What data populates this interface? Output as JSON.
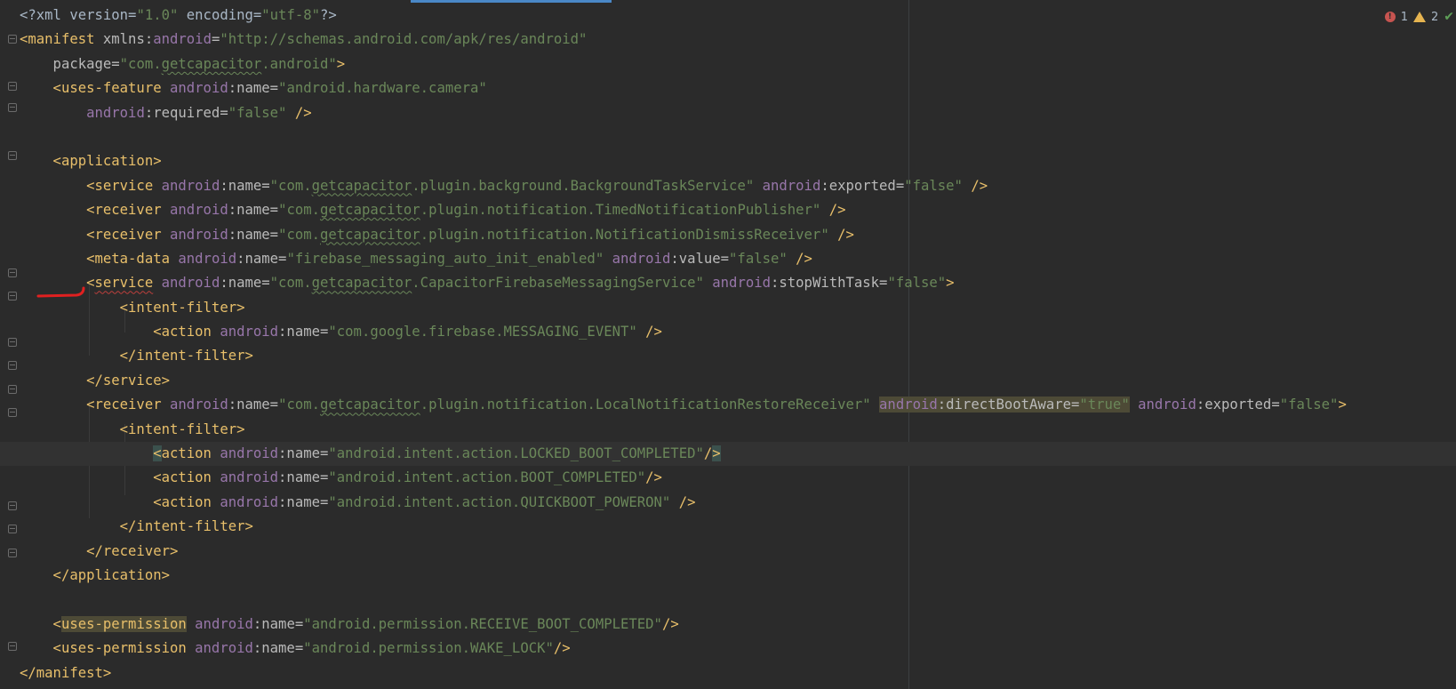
{
  "editor": {
    "indicators": {
      "errors": "1",
      "warnings": "2"
    },
    "colors": {
      "background": "#2b2b2b",
      "tag": "#e8bf6a",
      "namespace": "#9876aa",
      "value": "#6a8759",
      "text": "#a9b7c6",
      "accent": "#4a88c7"
    },
    "icons": [
      "error-icon",
      "warning-icon",
      "check-icon",
      "lightbulb-icon",
      "fold-marker-icon",
      "red-annotation-arrow"
    ],
    "lines": [
      {
        "tokens": [
          "<?xml version=",
          "\"1.0\"",
          " encoding=",
          "\"utf-8\"",
          "?>"
        ]
      },
      {
        "tokens": [
          "<manifest ",
          "xmlns",
          ":",
          "android",
          "=",
          "\"http://schemas.android.com/apk/res/android\""
        ]
      },
      {
        "tokens": [
          "    package=",
          "\"com.",
          "getcapacitor",
          ".android\"",
          ">"
        ]
      },
      {
        "tokens": [
          "    <uses-feature ",
          "android",
          ":name=",
          "\"android.hardware.camera\""
        ]
      },
      {
        "tokens": [
          "        ",
          "android",
          ":required=",
          "\"false\"",
          " />"
        ]
      },
      {
        "tokens": [
          ""
        ]
      },
      {
        "tokens": [
          "    <application>"
        ]
      },
      {
        "tokens": [
          "        <service ",
          "android",
          ":name=",
          "\"com.",
          "getcapacitor",
          ".plugin.background.BackgroundTaskService\"",
          " ",
          "android",
          ":exported=",
          "\"false\"",
          " />"
        ]
      },
      {
        "tokens": [
          "        <receiver ",
          "android",
          ":name=",
          "\"com.",
          "getcapacitor",
          ".plugin.notification.TimedNotificationPublisher\"",
          " />"
        ]
      },
      {
        "tokens": [
          "        <receiver ",
          "android",
          ":name=",
          "\"com.",
          "getcapacitor",
          ".plugin.notification.NotificationDismissReceiver\"",
          " />"
        ]
      },
      {
        "tokens": [
          "        <meta-data ",
          "android",
          ":name=",
          "\"firebase_messaging_auto_init_enabled\"",
          " ",
          "android",
          ":value=",
          "\"false\"",
          " />"
        ]
      },
      {
        "tokens": [
          "        <",
          "service",
          " ",
          "android",
          ":name=",
          "\"com.",
          "getcapacitor",
          ".CapacitorFirebaseMessagingService\"",
          " ",
          "android",
          ":stopWithTask=",
          "\"false\"",
          ">"
        ]
      },
      {
        "tokens": [
          "            <intent-filter>"
        ]
      },
      {
        "tokens": [
          "                <action ",
          "android",
          ":name=",
          "\"com.google.firebase.MESSAGING_EVENT\"",
          " />"
        ]
      },
      {
        "tokens": [
          "            </intent-filter>"
        ]
      },
      {
        "tokens": [
          "        </service>"
        ]
      },
      {
        "tokens": [
          "        <receiver ",
          "android",
          ":name=",
          "\"com.",
          "getcapacitor",
          ".plugin.notification.LocalNotificationRestoreReceiver\"",
          " ",
          "android",
          ":directBootAware=",
          "\"true\"",
          " ",
          "android",
          ":exported=",
          "\"false\"",
          ">"
        ]
      },
      {
        "tokens": [
          "            <intent-filter>"
        ]
      },
      {
        "tokens": [
          "                ",
          "<",
          "action ",
          "android",
          ":name=",
          "\"android.intent.action.LOCKED_BOOT_COMPLETED\"",
          "/",
          ">"
        ]
      },
      {
        "tokens": [
          "                <action ",
          "android",
          ":name=",
          "\"android.intent.action.BOOT_COMPLETED\"",
          "/>"
        ]
      },
      {
        "tokens": [
          "                <action ",
          "android",
          ":name=",
          "\"android.intent.action.QUICKBOOT_POWERON\"",
          " />"
        ]
      },
      {
        "tokens": [
          "            </intent-filter>"
        ]
      },
      {
        "tokens": [
          "        </receiver>"
        ]
      },
      {
        "tokens": [
          "    </application>"
        ]
      },
      {
        "tokens": [
          ""
        ]
      },
      {
        "tokens": [
          "    <",
          "uses-permission",
          " ",
          "android",
          ":name=",
          "\"android.permission.RECEIVE_BOOT_COMPLETED\"",
          "/>"
        ]
      },
      {
        "tokens": [
          "    <uses-permission ",
          "android",
          ":name=",
          "\"android.permission.WAKE_LOCK\"",
          "/>"
        ]
      },
      {
        "tokens": [
          "</manifest>"
        ]
      }
    ]
  }
}
